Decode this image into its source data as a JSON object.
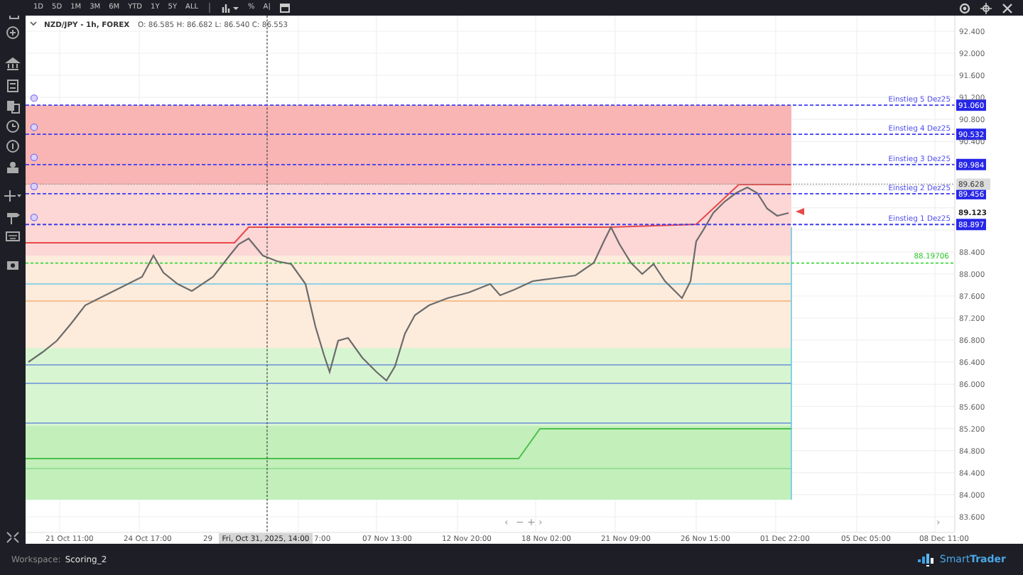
{
  "toolbar": {
    "ranges": [
      "1D",
      "5D",
      "1M",
      "3M",
      "6M",
      "YTD",
      "1Y",
      "5Y",
      "ALL"
    ],
    "tools": [
      "%",
      "A|"
    ]
  },
  "legend": {
    "symbol": "NZD/JPY - 1h, FOREX",
    "ohlc": "O: 86.585 H: 86.682 L: 86.540 C: 86.553"
  },
  "levels": [
    {
      "label": "Einstieg 5 Dez25",
      "price": "91.060"
    },
    {
      "label": "Einstieg 4 Dez25",
      "price": "90.532"
    },
    {
      "label": "Einstieg 3 Dez25",
      "price": "89.984"
    },
    {
      "label": "Einstieg 2 Dez25",
      "price": "89.456"
    },
    {
      "label": "Einstieg 1 Dez25",
      "price": "88.897"
    }
  ],
  "target": {
    "label": "88.19706"
  },
  "price_axis": {
    "ticks": [
      "92.400",
      "92.000",
      "91.600",
      "91.200",
      "90.800",
      "90.400",
      "88.400",
      "88.000",
      "87.600",
      "87.200",
      "86.800",
      "86.400",
      "86.000",
      "85.600",
      "85.200",
      "84.800",
      "84.400",
      "84.000",
      "83.600"
    ],
    "tags": [
      {
        "price": "89.628",
        "kind": "last"
      },
      {
        "price": "89.123",
        "kind": "current"
      }
    ]
  },
  "time_axis": {
    "labels": [
      "21 Oct 11:00",
      "24 Oct 17:00",
      "29",
      "7:00",
      "07 Nov 13:00",
      "12 Nov 20:00",
      "18 Nov 02:00",
      "21 Nov 09:00",
      "26 Nov 15:00",
      "01 Dec 22:00",
      "05 Dec 05:00",
      "08 Dec 11:00"
    ],
    "crosshair": "Fri, Oct 31, 2025, 14:00"
  },
  "chart_nav": [
    "‹",
    "−",
    "+",
    "›"
  ],
  "scroll_end": "›",
  "status_bar": {
    "workspace_label": "Workspace:",
    "workspace": "Scoring_2",
    "brand": "Smart**Trader**"
  }
}
